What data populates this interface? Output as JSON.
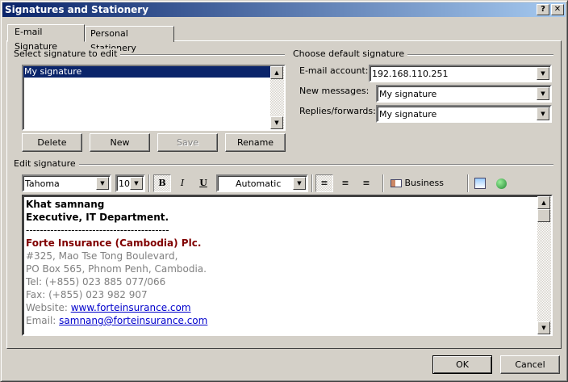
{
  "window": {
    "title": "Signatures and Stationery",
    "help": "?",
    "close": "✕"
  },
  "tabs": [
    {
      "label": "E-mail Signature"
    },
    {
      "label": "Personal Stationery"
    }
  ],
  "select": {
    "label": "Select signature to edit",
    "items": [
      "My signature"
    ],
    "buttons": {
      "delete": "Delete",
      "new": "New",
      "save": "Save",
      "rename": "Rename"
    }
  },
  "defaults": {
    "label": "Choose default signature",
    "account_label": "E-mail account:",
    "account_value": "192.168.110.251",
    "new_label": "New messages:",
    "new_value": "My signature",
    "replies_label": "Replies/forwards:",
    "replies_value": "My signature"
  },
  "edit": {
    "label": "Edit signature",
    "font": "Tahoma",
    "size": "10",
    "color": "Automatic",
    "business_card": "Business Card"
  },
  "signature": {
    "name": "Khat samnang",
    "title": "Executive, IT Department.",
    "divider": "-----------------------------------------",
    "company": "Forte Insurance (Cambodia) Plc.",
    "address1": "#325, Mao Tse Tong Boulevard,",
    "address2": "PO Box 565, Phnom Penh, Cambodia.",
    "tel": "Tel: (+855) 023 885 077/066",
    "fax": "Fax: (+855) 023 982 907",
    "website_label": "Website: ",
    "website": "www.forteinsurance.com",
    "email_label": "Email: ",
    "email": "samnang@forteinsurance.com",
    "company_color": "#800000"
  },
  "footer": {
    "ok": "OK",
    "cancel": "Cancel"
  }
}
